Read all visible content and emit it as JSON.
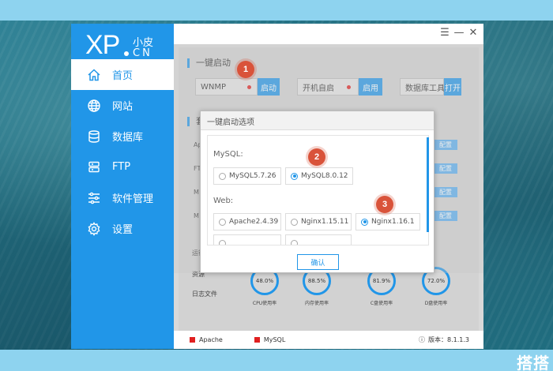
{
  "logo": {
    "brand": "XP",
    "name_cn": "小皮",
    "domain": "CN"
  },
  "window_controls": {
    "menu": "☰",
    "minimize": "—",
    "close": "✕"
  },
  "nav": [
    {
      "label": "首页",
      "icon": "home-icon",
      "active": true
    },
    {
      "label": "网站",
      "icon": "globe-icon"
    },
    {
      "label": "数据库",
      "icon": "database-icon"
    },
    {
      "label": "FTP",
      "icon": "ftp-icon"
    },
    {
      "label": "软件管理",
      "icon": "sliders-icon"
    },
    {
      "label": "设置",
      "icon": "gear-icon"
    }
  ],
  "quick_start": {
    "title": "一键启动",
    "wnmp": {
      "label": "WNMP",
      "button": "启动"
    },
    "autostart": {
      "label": "开机自启",
      "button": "启用"
    },
    "dbtool": {
      "label": "数据库工具",
      "button": "打开"
    }
  },
  "suite": {
    "title_partial": "套",
    "letters": [
      "Ap",
      "FT",
      "M",
      "M"
    ],
    "config_button": "配置"
  },
  "bottom_tabs": [
    "运行",
    "资源",
    "日志文件"
  ],
  "gauges": [
    {
      "value": "48.0%",
      "label": "CPU使用率"
    },
    {
      "value": "88.5%",
      "label": "内存使用率"
    },
    {
      "value": "81.9%",
      "label": "C盘使用率"
    },
    {
      "value": "72.0%",
      "label": "D盘使用率"
    }
  ],
  "footer": {
    "services": [
      "Apache",
      "MySQL"
    ],
    "version_label": "版本：",
    "version": "8.1.1.3",
    "info_icon": "ⓘ"
  },
  "dialog": {
    "title": "一键启动选项",
    "mysql_label": "MySQL:",
    "mysql_options": [
      {
        "label": "MySQL5.7.26",
        "selected": false
      },
      {
        "label": "MySQL8.0.12",
        "selected": true
      }
    ],
    "web_label": "Web:",
    "web_options": [
      {
        "label": "Apache2.4.39",
        "selected": false
      },
      {
        "label": "Nginx1.15.11",
        "selected": false
      },
      {
        "label": "Nginx1.16.1",
        "selected": true
      }
    ],
    "ok_button": "确认"
  },
  "markers": [
    "1",
    "2",
    "3"
  ],
  "watermark": "搭搭",
  "colors": {
    "accent": "#2196e8",
    "marker": "#d9533a",
    "status_red": "#e02020"
  }
}
